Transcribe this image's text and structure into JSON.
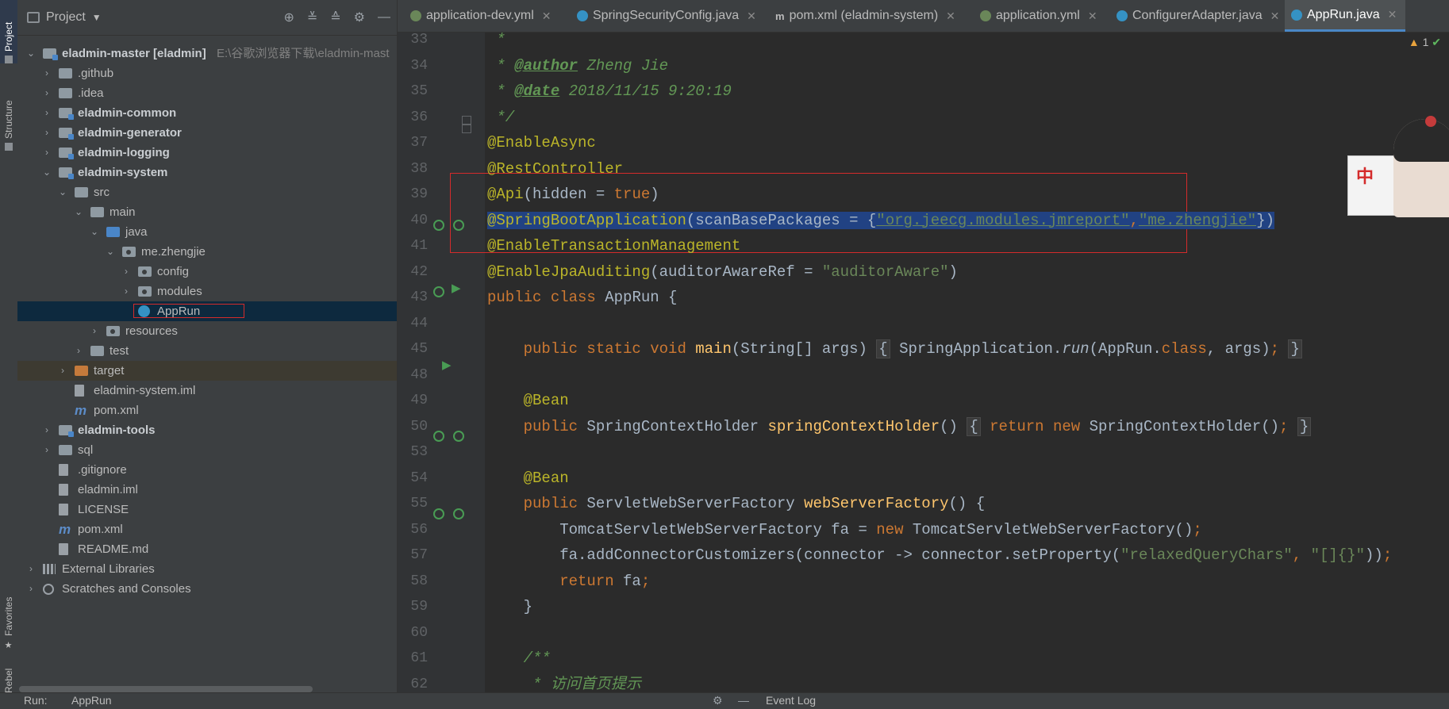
{
  "side_tabs": [
    "Project",
    "Structure",
    "Favorites",
    "JRebel"
  ],
  "project_panel": {
    "title": "Project",
    "tools": [
      "locate-icon",
      "expand-all-icon",
      "collapse-all-icon",
      "settings-icon",
      "hide-icon"
    ],
    "tree": [
      {
        "label": "eladmin-master [eladmin]",
        "path": "E:\\谷歌浏览器下载\\eladmin-mast",
        "depth": 0,
        "expanded": true,
        "icon": "module-folder",
        "bold": true
      },
      {
        "label": ".github",
        "depth": 1,
        "expanded": false,
        "icon": "folder"
      },
      {
        "label": ".idea",
        "depth": 1,
        "expanded": false,
        "icon": "folder"
      },
      {
        "label": "eladmin-common",
        "depth": 1,
        "expanded": false,
        "icon": "module-folder",
        "bold": true
      },
      {
        "label": "eladmin-generator",
        "depth": 1,
        "expanded": false,
        "icon": "module-folder",
        "bold": true
      },
      {
        "label": "eladmin-logging",
        "depth": 1,
        "expanded": false,
        "icon": "module-folder",
        "bold": true
      },
      {
        "label": "eladmin-system",
        "depth": 1,
        "expanded": true,
        "icon": "module-folder",
        "bold": true
      },
      {
        "label": "src",
        "depth": 2,
        "expanded": true,
        "icon": "folder"
      },
      {
        "label": "main",
        "depth": 3,
        "expanded": true,
        "icon": "folder"
      },
      {
        "label": "java",
        "depth": 4,
        "expanded": true,
        "icon": "source-folder"
      },
      {
        "label": "me.zhengjie",
        "depth": 5,
        "expanded": true,
        "icon": "package"
      },
      {
        "label": "config",
        "depth": 6,
        "expanded": false,
        "icon": "package"
      },
      {
        "label": "modules",
        "depth": 6,
        "expanded": false,
        "icon": "package"
      },
      {
        "label": "AppRun",
        "depth": 6,
        "icon": "java-class",
        "selected": true,
        "boxed": true
      },
      {
        "label": "resources",
        "depth": 4,
        "expanded": false,
        "icon": "resources-folder"
      },
      {
        "label": "test",
        "depth": 3,
        "expanded": false,
        "icon": "folder"
      },
      {
        "label": "target",
        "depth": 2,
        "expanded": false,
        "icon": "excluded-folder",
        "target": true
      },
      {
        "label": "eladmin-system.iml",
        "depth": 2,
        "icon": "file"
      },
      {
        "label": "pom.xml",
        "depth": 2,
        "icon": "maven"
      },
      {
        "label": "eladmin-tools",
        "depth": 1,
        "expanded": false,
        "icon": "module-folder",
        "bold": true
      },
      {
        "label": "sql",
        "depth": 1,
        "expanded": false,
        "icon": "folder"
      },
      {
        "label": ".gitignore",
        "depth": 1,
        "icon": "file"
      },
      {
        "label": "eladmin.iml",
        "depth": 1,
        "icon": "file"
      },
      {
        "label": "LICENSE",
        "depth": 1,
        "icon": "file"
      },
      {
        "label": "pom.xml",
        "depth": 1,
        "icon": "maven"
      },
      {
        "label": "README.md",
        "depth": 1,
        "icon": "file"
      },
      {
        "label": "External Libraries",
        "depth": 0,
        "expanded": false,
        "icon": "library"
      },
      {
        "label": "Scratches and Consoles",
        "depth": 0,
        "expanded": false,
        "icon": "scratch"
      }
    ]
  },
  "tabs": [
    {
      "label": "application-dev.yml",
      "icon": "yml",
      "active": false
    },
    {
      "label": "SpringSecurityConfig.java",
      "icon": "java",
      "active": false
    },
    {
      "label": "pom.xml (eladmin-system)",
      "icon": "maven",
      "active": false
    },
    {
      "label": "application.yml",
      "icon": "yml",
      "active": false
    },
    {
      "label": "ConfigurerAdapter.java",
      "icon": "java",
      "active": false
    },
    {
      "label": "AppRun.java",
      "icon": "java",
      "active": true
    }
  ],
  "inspection": {
    "warnings": "1",
    "ok": ""
  },
  "editor": {
    "lines": [
      {
        "num": "33",
        "tokens": [
          {
            "t": " *",
            "c": "cm"
          }
        ]
      },
      {
        "num": "34",
        "tokens": [
          {
            "t": " * ",
            "c": "cm"
          },
          {
            "t": "@author",
            "c": "tag"
          },
          {
            "t": " Zheng Jie",
            "c": "cm"
          }
        ]
      },
      {
        "num": "35",
        "tokens": [
          {
            "t": " * ",
            "c": "cm"
          },
          {
            "t": "@date",
            "c": "tag"
          },
          {
            "t": " 2018/11/15 9:20:19",
            "c": "cm"
          }
        ]
      },
      {
        "num": "36",
        "tokens": [
          {
            "t": " */",
            "c": "cm"
          }
        ]
      },
      {
        "num": "37",
        "tokens": [
          {
            "t": "@EnableAsync",
            "c": "an"
          }
        ]
      },
      {
        "num": "38",
        "tokens": [
          {
            "t": "@RestController",
            "c": "an"
          }
        ]
      },
      {
        "num": "39",
        "tokens": [
          {
            "t": "@Api",
            "c": "an"
          },
          {
            "t": "(hidden = ",
            "c": ""
          },
          {
            "t": "true",
            "c": "kw"
          },
          {
            "t": ")",
            "c": ""
          }
        ]
      },
      {
        "num": "40",
        "selected": true,
        "tokens": [
          {
            "t": "@SpringBootApplication",
            "c": "an"
          },
          {
            "t": "(scanBasePackages = {",
            "c": ""
          },
          {
            "t": "\"org.jeecg.modules.jmreport\"",
            "c": "str u"
          },
          {
            "t": ",",
            "c": "kw"
          },
          {
            "t": "\"me.zhengjie\"",
            "c": "str u"
          },
          {
            "t": "})",
            "c": ""
          }
        ]
      },
      {
        "num": "41",
        "tokens": [
          {
            "t": "@EnableTransactionManagement",
            "c": "an"
          }
        ]
      },
      {
        "num": "42",
        "tokens": [
          {
            "t": "@EnableJpaAuditing",
            "c": "an"
          },
          {
            "t": "(auditorAwareRef = ",
            "c": ""
          },
          {
            "t": "\"auditorAware\"",
            "c": "str"
          },
          {
            "t": ")",
            "c": ""
          }
        ]
      },
      {
        "num": "43",
        "tokens": [
          {
            "t": "public class ",
            "c": "kw"
          },
          {
            "t": "AppRun {",
            "c": ""
          }
        ]
      },
      {
        "num": "44",
        "tokens": []
      },
      {
        "num": "45",
        "tokens": [
          {
            "t": "    public static void ",
            "c": "kw"
          },
          {
            "t": "main",
            "c": "fn"
          },
          {
            "t": "(String[] args) ",
            "c": ""
          },
          {
            "t": "{",
            "c": "brace"
          },
          {
            "t": " SpringApplication.",
            "c": ""
          },
          {
            "t": "run",
            "c": "it"
          },
          {
            "t": "(AppRun.",
            "c": ""
          },
          {
            "t": "class",
            "c": "kw"
          },
          {
            "t": ", args)",
            "c": ""
          },
          {
            "t": ";",
            "c": "kw"
          },
          {
            "t": " ",
            "c": ""
          },
          {
            "t": "}",
            "c": "brace"
          }
        ]
      },
      {
        "num": "48",
        "tokens": []
      },
      {
        "num": "49",
        "tokens": [
          {
            "t": "    @Bean",
            "c": "an"
          }
        ]
      },
      {
        "num": "50",
        "tokens": [
          {
            "t": "    public ",
            "c": "kw"
          },
          {
            "t": "SpringContextHolder ",
            "c": ""
          },
          {
            "t": "springContextHolder",
            "c": "fn"
          },
          {
            "t": "() ",
            "c": ""
          },
          {
            "t": "{",
            "c": "brace"
          },
          {
            "t": " return new ",
            "c": "kw"
          },
          {
            "t": "SpringContextHolder()",
            "c": ""
          },
          {
            "t": ";",
            "c": "kw"
          },
          {
            "t": " ",
            "c": ""
          },
          {
            "t": "}",
            "c": "brace"
          }
        ]
      },
      {
        "num": "53",
        "tokens": []
      },
      {
        "num": "54",
        "tokens": [
          {
            "t": "    @Bean",
            "c": "an"
          }
        ]
      },
      {
        "num": "55",
        "tokens": [
          {
            "t": "    public ",
            "c": "kw"
          },
          {
            "t": "ServletWebServerFactory ",
            "c": ""
          },
          {
            "t": "webServerFactory",
            "c": "fn"
          },
          {
            "t": "() {",
            "c": ""
          }
        ]
      },
      {
        "num": "56",
        "tokens": [
          {
            "t": "        TomcatServletWebServerFactory fa = ",
            "c": ""
          },
          {
            "t": "new ",
            "c": "kw"
          },
          {
            "t": "TomcatServletWebServerFactory()",
            "c": ""
          },
          {
            "t": ";",
            "c": "kw"
          }
        ]
      },
      {
        "num": "57",
        "tokens": [
          {
            "t": "        fa.addConnectorCustomizers(connector -> connector.setProperty(",
            "c": ""
          },
          {
            "t": "\"relaxedQueryChars\"",
            "c": "str"
          },
          {
            "t": ", ",
            "c": "kw"
          },
          {
            "t": "\"[]{}\"",
            "c": "str"
          },
          {
            "t": "))",
            "c": ""
          },
          {
            "t": ";",
            "c": "kw"
          }
        ]
      },
      {
        "num": "58",
        "tokens": [
          {
            "t": "        return ",
            "c": "kw"
          },
          {
            "t": "fa",
            "c": ""
          },
          {
            "t": ";",
            "c": "kw"
          }
        ]
      },
      {
        "num": "59",
        "tokens": [
          {
            "t": "    }",
            "c": ""
          }
        ]
      },
      {
        "num": "60",
        "tokens": []
      },
      {
        "num": "61",
        "tokens": [
          {
            "t": "    /**",
            "c": "cm"
          }
        ]
      },
      {
        "num": "62",
        "tokens": [
          {
            "t": "     * 访问首页提示",
            "c": "cm"
          }
        ]
      }
    ]
  },
  "mascot": {
    "bubble_text": "中"
  },
  "bottom": {
    "run_label": "Run:",
    "run_config": "AppRun",
    "event_log": "Event Log"
  }
}
